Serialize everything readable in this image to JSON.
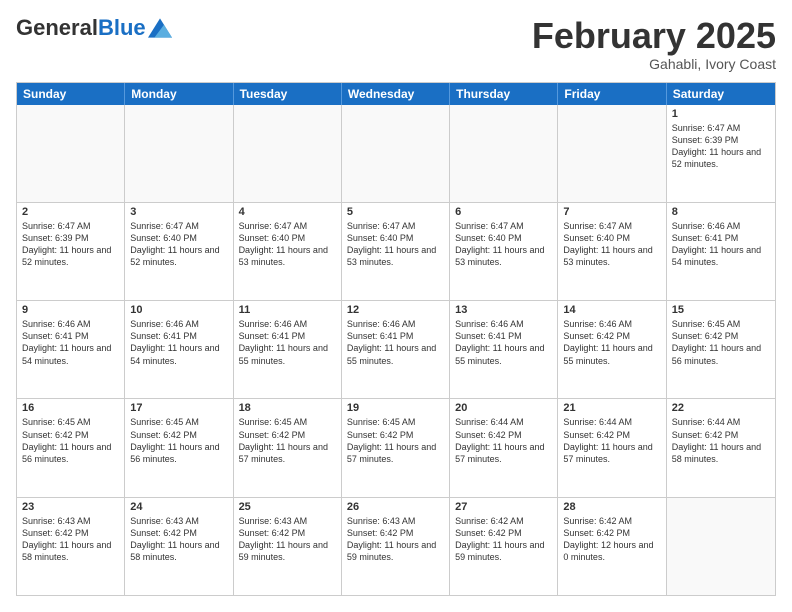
{
  "header": {
    "logo_general": "General",
    "logo_blue": "Blue",
    "month_title": "February 2025",
    "location": "Gahabli, Ivory Coast"
  },
  "weekdays": [
    "Sunday",
    "Monday",
    "Tuesday",
    "Wednesday",
    "Thursday",
    "Friday",
    "Saturday"
  ],
  "weeks": [
    [
      {
        "day": "",
        "info": ""
      },
      {
        "day": "",
        "info": ""
      },
      {
        "day": "",
        "info": ""
      },
      {
        "day": "",
        "info": ""
      },
      {
        "day": "",
        "info": ""
      },
      {
        "day": "",
        "info": ""
      },
      {
        "day": "1",
        "info": "Sunrise: 6:47 AM\nSunset: 6:39 PM\nDaylight: 11 hours and 52 minutes."
      }
    ],
    [
      {
        "day": "2",
        "info": "Sunrise: 6:47 AM\nSunset: 6:39 PM\nDaylight: 11 hours and 52 minutes."
      },
      {
        "day": "3",
        "info": "Sunrise: 6:47 AM\nSunset: 6:40 PM\nDaylight: 11 hours and 52 minutes."
      },
      {
        "day": "4",
        "info": "Sunrise: 6:47 AM\nSunset: 6:40 PM\nDaylight: 11 hours and 53 minutes."
      },
      {
        "day": "5",
        "info": "Sunrise: 6:47 AM\nSunset: 6:40 PM\nDaylight: 11 hours and 53 minutes."
      },
      {
        "day": "6",
        "info": "Sunrise: 6:47 AM\nSunset: 6:40 PM\nDaylight: 11 hours and 53 minutes."
      },
      {
        "day": "7",
        "info": "Sunrise: 6:47 AM\nSunset: 6:40 PM\nDaylight: 11 hours and 53 minutes."
      },
      {
        "day": "8",
        "info": "Sunrise: 6:46 AM\nSunset: 6:41 PM\nDaylight: 11 hours and 54 minutes."
      }
    ],
    [
      {
        "day": "9",
        "info": "Sunrise: 6:46 AM\nSunset: 6:41 PM\nDaylight: 11 hours and 54 minutes."
      },
      {
        "day": "10",
        "info": "Sunrise: 6:46 AM\nSunset: 6:41 PM\nDaylight: 11 hours and 54 minutes."
      },
      {
        "day": "11",
        "info": "Sunrise: 6:46 AM\nSunset: 6:41 PM\nDaylight: 11 hours and 55 minutes."
      },
      {
        "day": "12",
        "info": "Sunrise: 6:46 AM\nSunset: 6:41 PM\nDaylight: 11 hours and 55 minutes."
      },
      {
        "day": "13",
        "info": "Sunrise: 6:46 AM\nSunset: 6:41 PM\nDaylight: 11 hours and 55 minutes."
      },
      {
        "day": "14",
        "info": "Sunrise: 6:46 AM\nSunset: 6:42 PM\nDaylight: 11 hours and 55 minutes."
      },
      {
        "day": "15",
        "info": "Sunrise: 6:45 AM\nSunset: 6:42 PM\nDaylight: 11 hours and 56 minutes."
      }
    ],
    [
      {
        "day": "16",
        "info": "Sunrise: 6:45 AM\nSunset: 6:42 PM\nDaylight: 11 hours and 56 minutes."
      },
      {
        "day": "17",
        "info": "Sunrise: 6:45 AM\nSunset: 6:42 PM\nDaylight: 11 hours and 56 minutes."
      },
      {
        "day": "18",
        "info": "Sunrise: 6:45 AM\nSunset: 6:42 PM\nDaylight: 11 hours and 57 minutes."
      },
      {
        "day": "19",
        "info": "Sunrise: 6:45 AM\nSunset: 6:42 PM\nDaylight: 11 hours and 57 minutes."
      },
      {
        "day": "20",
        "info": "Sunrise: 6:44 AM\nSunset: 6:42 PM\nDaylight: 11 hours and 57 minutes."
      },
      {
        "day": "21",
        "info": "Sunrise: 6:44 AM\nSunset: 6:42 PM\nDaylight: 11 hours and 57 minutes."
      },
      {
        "day": "22",
        "info": "Sunrise: 6:44 AM\nSunset: 6:42 PM\nDaylight: 11 hours and 58 minutes."
      }
    ],
    [
      {
        "day": "23",
        "info": "Sunrise: 6:43 AM\nSunset: 6:42 PM\nDaylight: 11 hours and 58 minutes."
      },
      {
        "day": "24",
        "info": "Sunrise: 6:43 AM\nSunset: 6:42 PM\nDaylight: 11 hours and 58 minutes."
      },
      {
        "day": "25",
        "info": "Sunrise: 6:43 AM\nSunset: 6:42 PM\nDaylight: 11 hours and 59 minutes."
      },
      {
        "day": "26",
        "info": "Sunrise: 6:43 AM\nSunset: 6:42 PM\nDaylight: 11 hours and 59 minutes."
      },
      {
        "day": "27",
        "info": "Sunrise: 6:42 AM\nSunset: 6:42 PM\nDaylight: 11 hours and 59 minutes."
      },
      {
        "day": "28",
        "info": "Sunrise: 6:42 AM\nSunset: 6:42 PM\nDaylight: 12 hours and 0 minutes."
      },
      {
        "day": "",
        "info": ""
      }
    ]
  ]
}
